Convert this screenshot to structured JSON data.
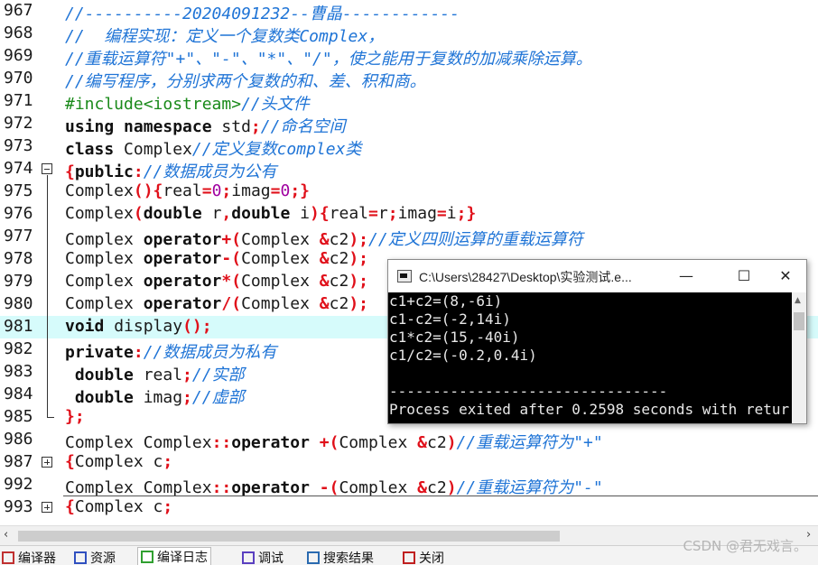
{
  "editor": {
    "lines": [
      {
        "num": "967",
        "segs": [
          {
            "t": "//----------20204091232--曹晶------------",
            "c": "cm"
          }
        ]
      },
      {
        "num": "968",
        "segs": [
          {
            "t": "//  编程实现：定义一个复数类Complex，",
            "c": "cm"
          }
        ]
      },
      {
        "num": "969",
        "segs": [
          {
            "t": "//重载运算符\"+\"、\"-\"、\"*\"、\"/\"，使之能用于复数的加减乘除运算。",
            "c": "cm"
          }
        ]
      },
      {
        "num": "970",
        "segs": [
          {
            "t": "//编写程序，分别求两个复数的和、差、积和商。",
            "c": "cm"
          }
        ]
      },
      {
        "num": "971",
        "segs": [
          {
            "t": "#include<iostream>",
            "c": "pp"
          },
          {
            "t": "//头文件",
            "c": "cm"
          }
        ]
      },
      {
        "num": "972",
        "segs": [
          {
            "t": "using namespace",
            "c": "kw"
          },
          {
            "t": " std",
            "c": ""
          },
          {
            "t": ";",
            "c": "sym"
          },
          {
            "t": "//命名空间",
            "c": "cm"
          }
        ]
      },
      {
        "num": "973",
        "segs": [
          {
            "t": "class",
            "c": "kw"
          },
          {
            "t": " Complex",
            "c": ""
          },
          {
            "t": "//定义复数complex类",
            "c": "cm"
          }
        ]
      },
      {
        "num": "974",
        "fold": "minus",
        "segs": [
          {
            "t": "{",
            "c": "sym"
          },
          {
            "t": "public",
            "c": "kw"
          },
          {
            "t": ":",
            "c": "sym"
          },
          {
            "t": "//数据成员为公有",
            "c": "cm"
          }
        ]
      },
      {
        "num": "975",
        "segs": [
          {
            "t": "Complex",
            "c": ""
          },
          {
            "t": "(){",
            "c": "sym"
          },
          {
            "t": "real",
            "c": ""
          },
          {
            "t": "=",
            "c": "sym"
          },
          {
            "t": "0",
            "c": "num"
          },
          {
            "t": ";",
            "c": "sym"
          },
          {
            "t": "imag",
            "c": ""
          },
          {
            "t": "=",
            "c": "sym"
          },
          {
            "t": "0",
            "c": "num"
          },
          {
            "t": ";}",
            "c": "sym"
          }
        ]
      },
      {
        "num": "976",
        "segs": [
          {
            "t": "Complex",
            "c": ""
          },
          {
            "t": "(",
            "c": "sym"
          },
          {
            "t": "double",
            "c": "kw"
          },
          {
            "t": " r",
            "c": ""
          },
          {
            "t": ",",
            "c": "sym"
          },
          {
            "t": "double",
            "c": "kw"
          },
          {
            "t": " i",
            "c": ""
          },
          {
            "t": "){",
            "c": "sym"
          },
          {
            "t": "real",
            "c": ""
          },
          {
            "t": "=",
            "c": "sym"
          },
          {
            "t": "r",
            "c": ""
          },
          {
            "t": ";",
            "c": "sym"
          },
          {
            "t": "imag",
            "c": ""
          },
          {
            "t": "=",
            "c": "sym"
          },
          {
            "t": "i",
            "c": ""
          },
          {
            "t": ";}",
            "c": "sym"
          }
        ]
      },
      {
        "num": "977",
        "segs": [
          {
            "t": "Complex ",
            "c": ""
          },
          {
            "t": "operator",
            "c": "kw"
          },
          {
            "t": "+(",
            "c": "sym"
          },
          {
            "t": "Complex ",
            "c": ""
          },
          {
            "t": "&",
            "c": "sym"
          },
          {
            "t": "c2",
            "c": ""
          },
          {
            "t": ");",
            "c": "sym"
          },
          {
            "t": "//定义四则运算的重载运算符",
            "c": "cm"
          }
        ]
      },
      {
        "num": "978",
        "segs": [
          {
            "t": "Complex ",
            "c": ""
          },
          {
            "t": "operator",
            "c": "kw"
          },
          {
            "t": "-(",
            "c": "sym"
          },
          {
            "t": "Complex ",
            "c": ""
          },
          {
            "t": "&",
            "c": "sym"
          },
          {
            "t": "c2",
            "c": ""
          },
          {
            "t": ");",
            "c": "sym"
          }
        ]
      },
      {
        "num": "979",
        "segs": [
          {
            "t": "Complex ",
            "c": ""
          },
          {
            "t": "operator",
            "c": "kw"
          },
          {
            "t": "*(",
            "c": "sym"
          },
          {
            "t": "Complex ",
            "c": ""
          },
          {
            "t": "&",
            "c": "sym"
          },
          {
            "t": "c2",
            "c": ""
          },
          {
            "t": ");",
            "c": "sym"
          }
        ]
      },
      {
        "num": "980",
        "segs": [
          {
            "t": "Complex ",
            "c": ""
          },
          {
            "t": "operator",
            "c": "kw"
          },
          {
            "t": "/(",
            "c": "sym"
          },
          {
            "t": "Complex ",
            "c": ""
          },
          {
            "t": "&",
            "c": "sym"
          },
          {
            "t": "c2",
            "c": ""
          },
          {
            "t": ");",
            "c": "sym"
          }
        ]
      },
      {
        "num": "981",
        "hl": true,
        "segs": [
          {
            "t": "void",
            "c": "kw"
          },
          {
            "t": " display",
            "c": ""
          },
          {
            "t": "();",
            "c": "sym"
          }
        ]
      },
      {
        "num": "982",
        "segs": [
          {
            "t": "private",
            "c": "kw"
          },
          {
            "t": ":",
            "c": "sym"
          },
          {
            "t": "//数据成员为私有",
            "c": "cm"
          }
        ]
      },
      {
        "num": "983",
        "segs": [
          {
            "t": " double",
            "c": "kw"
          },
          {
            "t": " real",
            "c": ""
          },
          {
            "t": ";",
            "c": "sym"
          },
          {
            "t": "//实部",
            "c": "cm"
          }
        ]
      },
      {
        "num": "984",
        "segs": [
          {
            "t": " double",
            "c": "kw"
          },
          {
            "t": " imag",
            "c": ""
          },
          {
            "t": ";",
            "c": "sym"
          },
          {
            "t": "//虚部",
            "c": "cm"
          }
        ]
      },
      {
        "num": "985",
        "segs": [
          {
            "t": "};",
            "c": "sym"
          }
        ]
      },
      {
        "num": "986",
        "segs": [
          {
            "t": "Complex Complex",
            "c": ""
          },
          {
            "t": "::",
            "c": "sym"
          },
          {
            "t": "operator",
            "c": "kw"
          },
          {
            "t": " +(",
            "c": "sym"
          },
          {
            "t": "Complex ",
            "c": ""
          },
          {
            "t": "&",
            "c": "sym"
          },
          {
            "t": "c2",
            "c": ""
          },
          {
            "t": ")",
            "c": "sym"
          },
          {
            "t": "//重载运算符为\"+\"",
            "c": "cm"
          }
        ]
      },
      {
        "num": "987",
        "fold": "plus",
        "segs": [
          {
            "t": "{",
            "c": "sym"
          },
          {
            "t": "Complex c",
            "c": ""
          },
          {
            "t": ";",
            "c": "sym"
          }
        ]
      },
      {
        "num": "992",
        "segs": [
          {
            "t": "Complex Complex",
            "c": ""
          },
          {
            "t": "::",
            "c": "sym"
          },
          {
            "t": "operator",
            "c": "kw"
          },
          {
            "t": " -(",
            "c": "sym"
          },
          {
            "t": "Complex ",
            "c": ""
          },
          {
            "t": "&",
            "c": "sym"
          },
          {
            "t": "c2",
            "c": ""
          },
          {
            "t": ")",
            "c": "sym"
          },
          {
            "t": "//重载运算符为\"-\"",
            "c": "cm"
          }
        ]
      },
      {
        "num": "993",
        "fold": "plus",
        "segs": [
          {
            "t": "{",
            "c": "sym"
          },
          {
            "t": "Complex c",
            "c": ""
          },
          {
            "t": ";",
            "c": "sym"
          }
        ]
      }
    ]
  },
  "console": {
    "title": "C:\\Users\\28427\\Desktop\\实验测试.e...",
    "minimize": "—",
    "maximize": "☐",
    "close": "✕",
    "output": [
      "c1+c2=(8,-6i)",
      "c1-c2=(-2,14i)",
      "c1*c2=(15,-40i)",
      "c1/c2=(-0.2,0.4i)",
      "",
      "--------------------------------",
      "Process exited after 0.2598 seconds with retur"
    ]
  },
  "tabs": [
    {
      "label": "编译器",
      "color": "#c03030",
      "active": false
    },
    {
      "label": "资源",
      "color": "#3050c0",
      "active": false
    },
    {
      "label": "编译日志",
      "color": "#30a030",
      "active": true
    },
    {
      "label": "调试",
      "color": "#5a40c0",
      "active": false
    },
    {
      "label": "搜索结果",
      "color": "#2a6ab0",
      "active": false
    },
    {
      "label": "关闭",
      "color": "#c02020",
      "active": false
    }
  ],
  "watermark": "CSDN @君无戏言。"
}
